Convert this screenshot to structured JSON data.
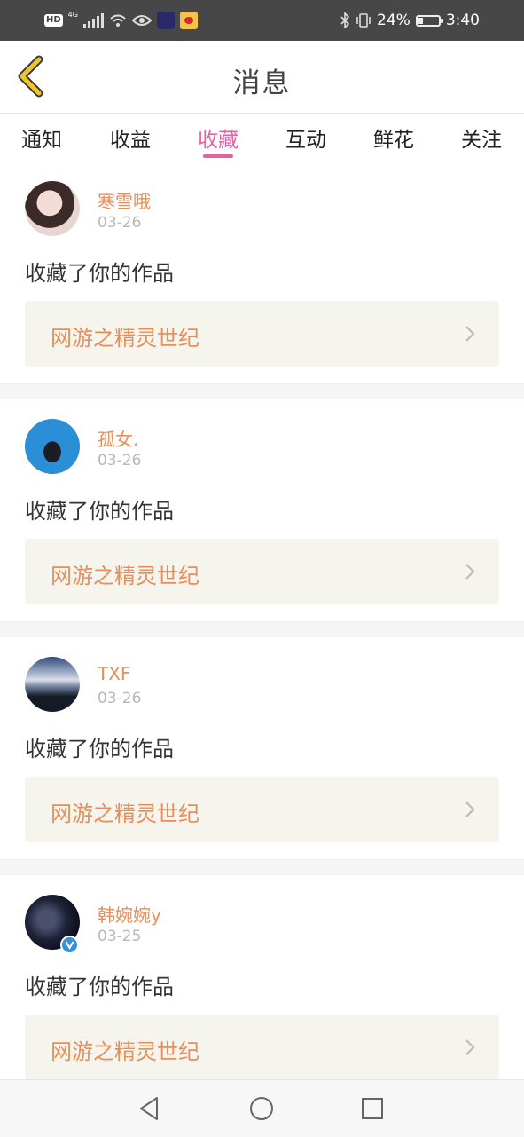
{
  "status_bar": {
    "hd_label": "HD",
    "network": "4G",
    "battery_percent": "24%",
    "battery_level": 0.24,
    "time": "3:40",
    "icons": [
      "signal-icon",
      "wifi-icon",
      "eye-icon",
      "app-icon",
      "weibo-icon",
      "bluetooth-icon",
      "vibrate-icon",
      "battery-icon"
    ]
  },
  "header": {
    "title": "消息",
    "back_icon": "chevron-left-icon"
  },
  "tabs": [
    {
      "label": "通知"
    },
    {
      "label": "收益"
    },
    {
      "label": "收藏",
      "active": true
    },
    {
      "label": "互动"
    },
    {
      "label": "鲜花"
    },
    {
      "label": "关注"
    }
  ],
  "items": [
    {
      "name": "寒雪哦",
      "date": "03-26",
      "action": "收藏了你的作品",
      "work_title": "网游之精灵世纪"
    },
    {
      "name": "孤女.",
      "date": "03-26",
      "action": "收藏了你的作品",
      "work_title": "网游之精灵世纪"
    },
    {
      "name": "TXF",
      "date": "03-26",
      "action": "收藏了你的作品",
      "work_title": "网游之精灵世纪"
    },
    {
      "name": "韩婉婉y",
      "date": "03-25",
      "action": "收藏了你的作品",
      "work_title": "网游之精灵世纪",
      "verified": true
    }
  ],
  "colors": {
    "accent": "#e562a0",
    "name": "#e88e5a",
    "card_bg": "#f5f5ee",
    "back": "#f2c530"
  }
}
